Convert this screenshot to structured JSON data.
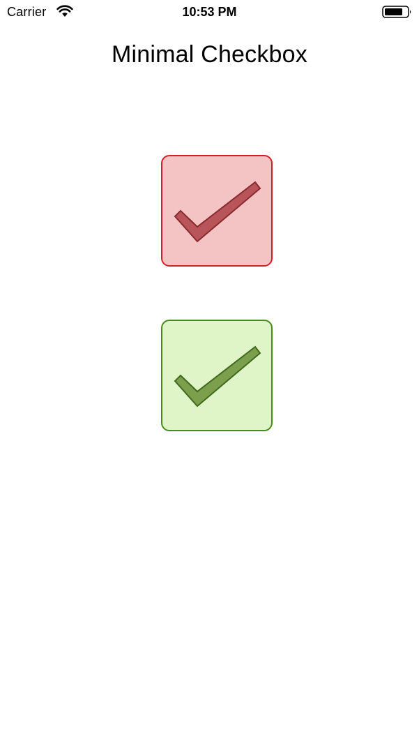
{
  "status_bar": {
    "carrier": "Carrier",
    "time": "10:53 PM",
    "wifi_icon": "wifi-icon",
    "battery_icon": "battery-icon"
  },
  "screen": {
    "title": "Minimal Checkbox"
  },
  "checkboxes": [
    {
      "name": "red",
      "checked": true,
      "icon": "checkmark-icon",
      "fill": "#f4c4c5",
      "border": "#d0202a",
      "check_fill": "#b8555a",
      "check_stroke": "#8a2a2e"
    },
    {
      "name": "green",
      "checked": true,
      "icon": "checkmark-icon",
      "fill": "#dff5c8",
      "border": "#4a8a1a",
      "check_fill": "#7c9f4e",
      "check_stroke": "#3f6a1c"
    }
  ]
}
